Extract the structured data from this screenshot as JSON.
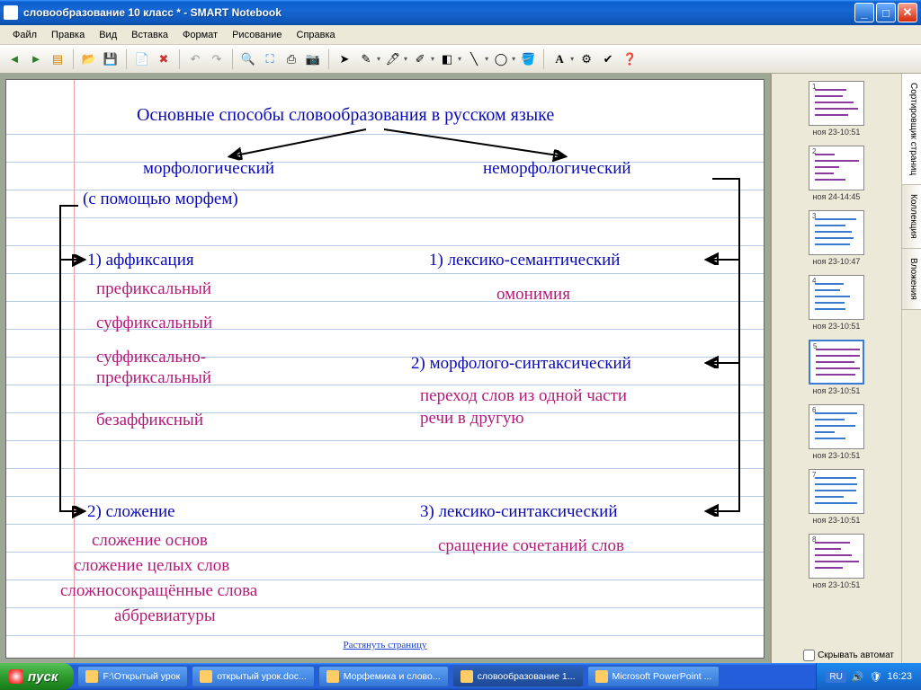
{
  "window": {
    "title": "словообразование 10 класс * - SMART Notebook"
  },
  "menu": {
    "file": "Файл",
    "edit": "Правка",
    "view": "Вид",
    "insert": "Вставка",
    "format": "Формат",
    "drawing": "Рисование",
    "help": "Справка"
  },
  "toolbar_icons": [
    "prev",
    "next",
    "doc",
    "open",
    "save",
    "new-page",
    "delete",
    "screen",
    "undo",
    "redo",
    "zoom",
    "fullscreen",
    "capture",
    "camera",
    "pointer",
    "pen",
    "highlighter",
    "creative-pen",
    "eraser",
    "line",
    "shape",
    "fill",
    "text",
    "props",
    "spell",
    "help-btn"
  ],
  "content": {
    "title": "Основные способы словообразования в русском языке",
    "left_branch": "морфологический",
    "left_note": "(с помощью морфем)",
    "l1": "1) аффиксация",
    "l1a": "префиксальный",
    "l1b": "суффиксальный",
    "l1c": "суффиксально-\nпрефиксальный",
    "l1d": "безаффиксный",
    "l2": "2) сложение",
    "l2a": "сложение основ",
    "l2b": "сложение целых слов",
    "l2c": "сложносокращённые слова",
    "l2d": "аббревиатуры",
    "right_branch": "неморфологический",
    "r1": "1) лексико-семантический",
    "r1a": "омонимия",
    "r2": "2) морфолого-синтаксический",
    "r2a": "переход слов из одной части\nречи в другую",
    "r3": "3) лексико-синтаксический",
    "r3a": "сращение сочетаний слов",
    "stretch": "Растянуть страницу"
  },
  "side_tabs": {
    "sorter": "Сортировщик страниц",
    "collection": "Коллекция",
    "attach": "Вложения"
  },
  "thumbs": [
    {
      "n": "1",
      "label": "ноя 23-10:51"
    },
    {
      "n": "2",
      "label": "ноя 24-14:45"
    },
    {
      "n": "3",
      "label": "ноя 23-10:47"
    },
    {
      "n": "4",
      "label": "ноя 23-10:51"
    },
    {
      "n": "5",
      "label": "ноя 23-10:51",
      "selected": true
    },
    {
      "n": "6",
      "label": "ноя 23-10:51"
    },
    {
      "n": "7",
      "label": "ноя 23-10:51"
    },
    {
      "n": "8",
      "label": "ноя 23-10:51"
    }
  ],
  "hide_auto": "Скрывать автомат",
  "taskbar": {
    "start": "пуск",
    "tasks": [
      "F:\\Открытый урок",
      "открытый урок.doc...",
      "Морфемика и слово...",
      "словообразование 1...",
      "Microsoft PowerPoint ..."
    ],
    "lang": "RU",
    "clock": "16:23"
  }
}
